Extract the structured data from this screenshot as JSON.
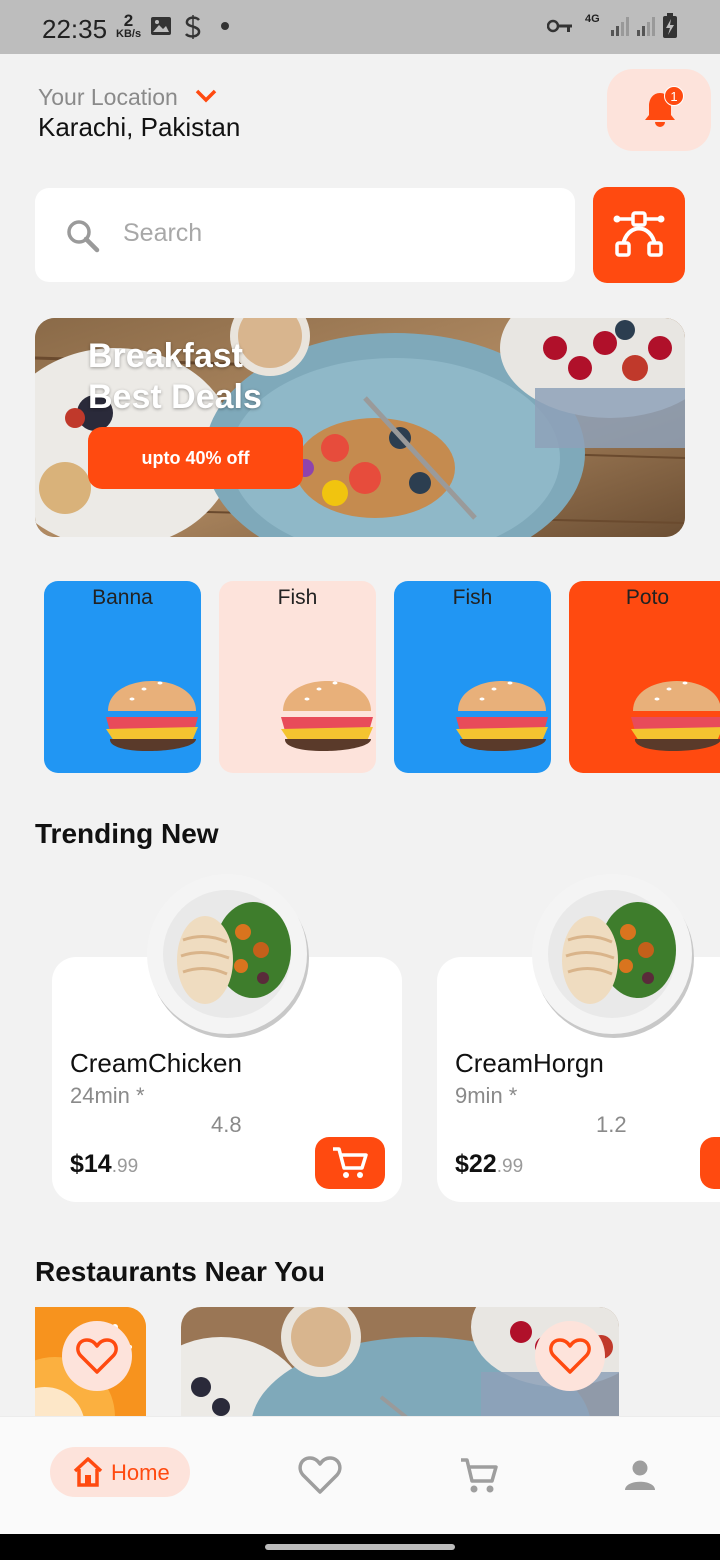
{
  "status_bar": {
    "time": "22:35",
    "speed_value": "2",
    "speed_unit": "KB/s",
    "network": "4G",
    "icons": [
      "gallery-icon",
      "app-s-icon",
      "dot-icon",
      "vpn-key-icon",
      "signal-icon",
      "signal-icon",
      "battery-charging-icon"
    ]
  },
  "header": {
    "location_label": "Your Location",
    "location_value": "Karachi, Pakistan",
    "notification_count": "1"
  },
  "search": {
    "placeholder": "Search",
    "value": ""
  },
  "banner": {
    "title_line1": "Breakfast",
    "title_line2": "Best Deals",
    "cta": "upto 40% off"
  },
  "categories": [
    {
      "label": "Banna",
      "bg": "#2196f3"
    },
    {
      "label": "Fish",
      "bg": "#fde3db"
    },
    {
      "label": "Fish",
      "bg": "#2196f3"
    },
    {
      "label": "Poto",
      "bg": "#ff4a10"
    }
  ],
  "trending": {
    "title": "Trending New",
    "items": [
      {
        "name": "CreamChicken",
        "time": "24min *",
        "rating": "4.8",
        "price_main": "$14",
        "price_cents": ".99"
      },
      {
        "name": "CreamHorgn",
        "time": "9min *",
        "rating": "1.2",
        "price_main": "$22",
        "price_cents": ".99"
      }
    ]
  },
  "restaurants": {
    "title": "Restaurants Near You"
  },
  "bottom_nav": {
    "home_label": "Home",
    "items": [
      "home-icon",
      "heart-icon",
      "cart-icon",
      "person-icon"
    ]
  },
  "colors": {
    "accent": "#ff4a10",
    "accent_light": "#fde3db",
    "blue": "#2196f3",
    "background": "#f2f2f2"
  }
}
